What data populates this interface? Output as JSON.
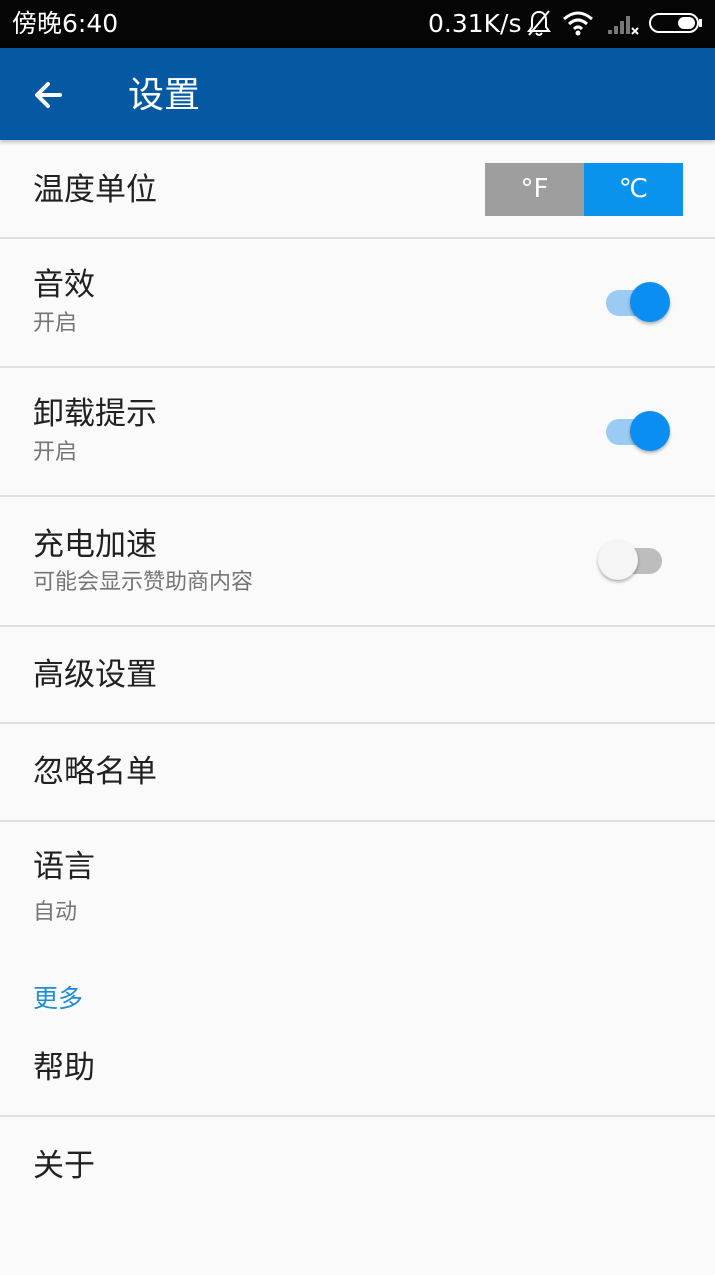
{
  "status_bar": {
    "time": "傍晚6:40",
    "network_speed": "0.31K/s",
    "icons": [
      "bell-muted-icon",
      "wifi-icon",
      "signal-icon",
      "battery-icon"
    ]
  },
  "app_bar": {
    "back_icon": "arrow-left-icon",
    "title": "设置"
  },
  "settings": {
    "temperature": {
      "title": "温度单位",
      "options": [
        "°F",
        "℃"
      ],
      "selected": "℃"
    },
    "sound": {
      "title": "音效",
      "subtitle": "开启",
      "enabled": true
    },
    "uninstall_tip": {
      "title": "卸载提示",
      "subtitle": "开启",
      "enabled": true
    },
    "charge_boost": {
      "title": "充电加速",
      "subtitle": "可能会显示赞助商内容",
      "enabled": false
    },
    "advanced": {
      "title": "高级设置"
    },
    "ignore_list": {
      "title": "忽略名单"
    },
    "language": {
      "title": "语言",
      "subtitle": "自动"
    }
  },
  "more": {
    "header": "更多",
    "help": "帮助",
    "about": "关于"
  },
  "colors": {
    "app_bar": "#0559a3",
    "accent": "#0a93ec",
    "section_header": "#1e8ed1"
  }
}
